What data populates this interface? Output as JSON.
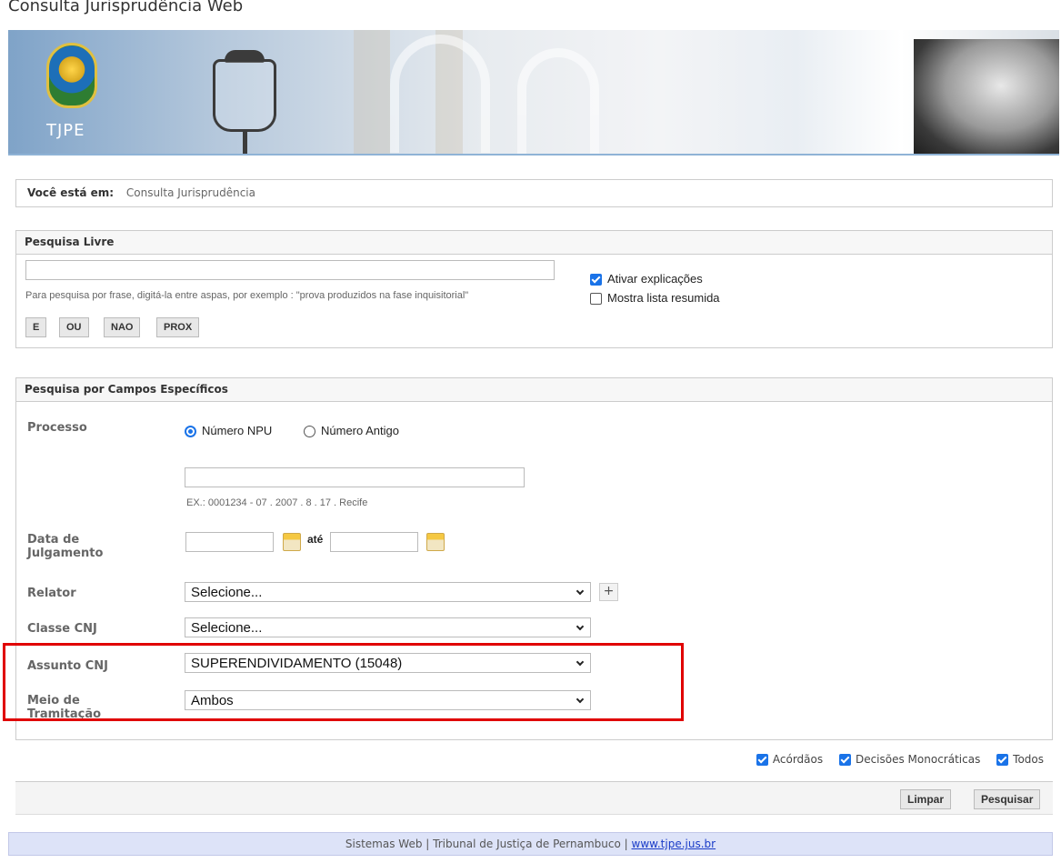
{
  "app": {
    "title": "Consulta Jurisprudência Web"
  },
  "banner": {
    "logo_text": "TJPE"
  },
  "breadcrumb": {
    "label": "Você está em:",
    "current": "Consulta Jurisprudência"
  },
  "free_search": {
    "title": "Pesquisa Livre",
    "input_value": "",
    "hint": "Para pesquisa por frase, digitá-la entre aspas, por exemplo : \"prova produzidos na fase inquisitorial\"",
    "operators": [
      "E",
      "OU",
      "NAO",
      "PROX"
    ],
    "options": [
      {
        "label": "Ativar explicações",
        "checked": true
      },
      {
        "label": "Mostra lista resumida",
        "checked": false
      }
    ]
  },
  "specific": {
    "title": "Pesquisa por Campos Específicos",
    "processo": {
      "label": "Processo",
      "radio_npu": "Número NPU",
      "radio_antigo": "Número Antigo",
      "selected": "Número NPU",
      "input_value": "",
      "example": "EX.: 0001234 - 07 . 2007 . 8 . 17 . Recife"
    },
    "data_julgamento": {
      "label_line1": "Data de",
      "label_line2": "Julgamento",
      "ate": "até",
      "from": "",
      "to": ""
    },
    "relator": {
      "label": "Relator",
      "value": "Selecione...",
      "add": "+"
    },
    "classe": {
      "label": "Classe CNJ",
      "value": "Selecione..."
    },
    "assunto": {
      "label": "Assunto CNJ",
      "value": "SUPERENDIVIDAMENTO (15048)"
    },
    "meio": {
      "label_line1": "Meio de",
      "label_line2": "Tramitação",
      "value": "Ambos"
    }
  },
  "filters": [
    {
      "label": "Acórdãos",
      "checked": true
    },
    {
      "label": "Decisões Monocráticas",
      "checked": true
    },
    {
      "label": "Todos",
      "checked": true
    }
  ],
  "actions": {
    "clear": "Limpar",
    "search": "Pesquisar"
  },
  "footer": {
    "text": "Sistemas Web | Tribunal de Justiça de Pernambuco | ",
    "link": "www.tjpe.jus.br"
  }
}
